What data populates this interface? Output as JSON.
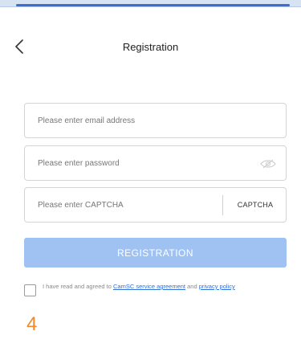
{
  "header": {
    "title": "Registration"
  },
  "form": {
    "email_placeholder": "Please enter email address",
    "password_placeholder": "Please enter password",
    "captcha_placeholder": "Please enter CAPTCHA",
    "captcha_button_label": "CAPTCHA",
    "submit_label": "REGISTRATION"
  },
  "agreement": {
    "prefix": "I have read and agreed to ",
    "service_link": "CamSC service agreement",
    "middle": " and ",
    "privacy_link": "privacy policy"
  },
  "annotation": {
    "step_number": "4"
  },
  "colors": {
    "accent": "#9fc2f3",
    "link": "#2f6fd6",
    "step_number": "#f08a2a"
  },
  "icons": {
    "back": "chevron-left-icon",
    "password_visibility": "eye-off-icon"
  }
}
